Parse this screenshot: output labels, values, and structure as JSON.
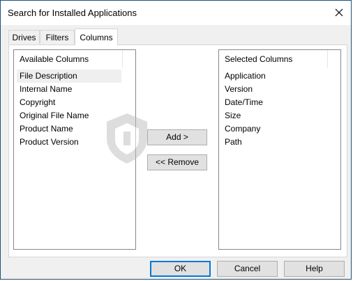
{
  "window": {
    "title": "Search for Installed Applications"
  },
  "tabs": [
    {
      "label": "Drives"
    },
    {
      "label": "Filters"
    },
    {
      "label": "Columns"
    }
  ],
  "available": {
    "header": "Available Columns",
    "items": [
      "File Description",
      "Internal Name",
      "Copyright",
      "Original File Name",
      "Product Name",
      "Product Version"
    ]
  },
  "selected": {
    "header": "Selected Columns",
    "items": [
      "Application",
      "Version",
      "Date/Time",
      "Size",
      "Company",
      "Path"
    ]
  },
  "buttons": {
    "add": "Add >",
    "remove": "<< Remove",
    "ok": "OK",
    "cancel": "Cancel",
    "help": "Help"
  },
  "icons": {
    "close": "close-icon",
    "watermark": "shield-logo-icon"
  },
  "colors": {
    "accent": "#0078d7",
    "selection": "#efefef"
  }
}
